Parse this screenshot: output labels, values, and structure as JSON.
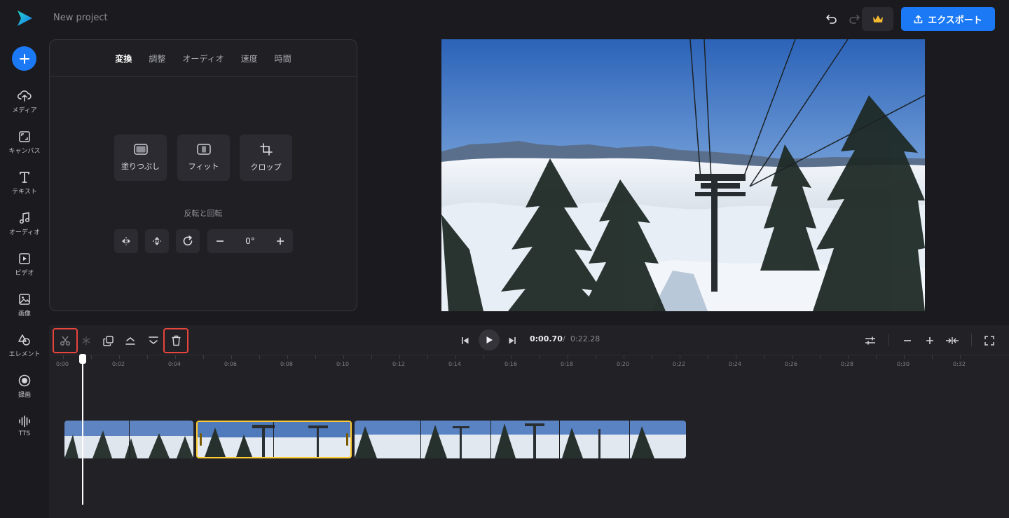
{
  "app": {
    "project_title": "New project",
    "export_label": "エクスポート"
  },
  "sidebar": {
    "items": [
      {
        "label": "メディア",
        "icon": "upload-cloud-icon"
      },
      {
        "label": "キャンバス",
        "icon": "canvas-icon"
      },
      {
        "label": "テキスト",
        "icon": "text-icon"
      },
      {
        "label": "オーディオ",
        "icon": "music-note-icon"
      },
      {
        "label": "ビデオ",
        "icon": "video-icon"
      },
      {
        "label": "画像",
        "icon": "image-icon"
      },
      {
        "label": "エレメント",
        "icon": "shapes-icon"
      },
      {
        "label": "録画",
        "icon": "record-icon"
      },
      {
        "label": "TTS",
        "icon": "tts-waveform-icon"
      }
    ]
  },
  "panel": {
    "tabs": [
      {
        "label": "変換",
        "active": true
      },
      {
        "label": "調整",
        "active": false
      },
      {
        "label": "オーディオ",
        "active": false
      },
      {
        "label": "速度",
        "active": false
      },
      {
        "label": "時間",
        "active": false
      }
    ],
    "fit_buttons": [
      {
        "label": "塗りつぶし",
        "icon": "fill-icon"
      },
      {
        "label": "フィット",
        "icon": "fit-icon"
      },
      {
        "label": "クロップ",
        "icon": "crop-icon"
      }
    ],
    "flip_rotate_label": "反転と回転",
    "rotation_value": "0°"
  },
  "timeline": {
    "current_time": "0:00.70",
    "separator": "/",
    "total_time": "0:22.28",
    "ruler_labels": [
      "0:00",
      "0:02",
      "0:04",
      "0:06",
      "0:08",
      "0:10",
      "0:12",
      "0:14",
      "0:16",
      "0:18",
      "0:20",
      "0:22",
      "0:24",
      "0:26",
      "0:28",
      "0:30",
      "0:32"
    ],
    "clips": [
      {
        "selected": false,
        "thumbs": 2
      },
      {
        "selected": true,
        "thumbs": 2
      },
      {
        "selected": false,
        "thumbs": 5
      }
    ]
  },
  "colors": {
    "accent": "#1b79f5",
    "selection": "#ffcc33",
    "highlight": "#e8453c",
    "background": "#1b1b1f"
  }
}
